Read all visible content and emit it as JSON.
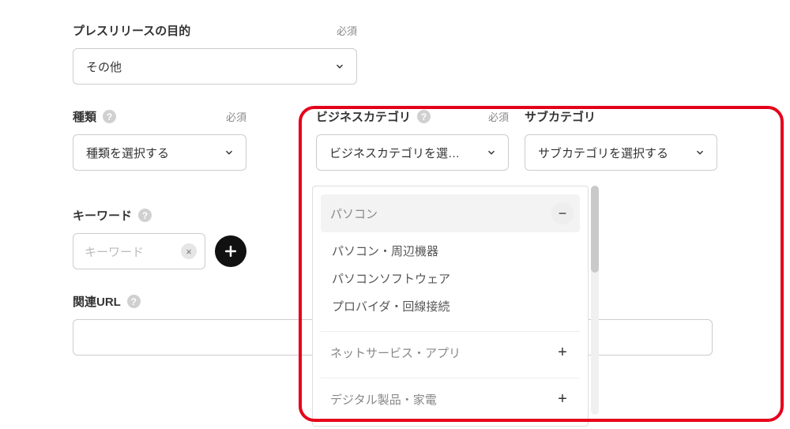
{
  "required_label": "必須",
  "purpose": {
    "label": "プレスリリースの目的",
    "value": "その他"
  },
  "type": {
    "label": "種類",
    "value": "種類を選択する"
  },
  "business_category": {
    "label": "ビジネスカテゴリ",
    "value": "ビジネスカテゴリを選…"
  },
  "sub_category": {
    "label": "サブカテゴリ",
    "value": "サブカテゴリを選択する"
  },
  "keyword": {
    "label": "キーワード",
    "placeholder": "キーワード"
  },
  "related_url": {
    "label": "関連URL"
  },
  "category_panel": {
    "groups": [
      {
        "title": "パソコン",
        "expanded": true,
        "items": [
          "パソコン・周辺機器",
          "パソコンソフトウェア",
          "プロバイダ・回線接続"
        ]
      },
      {
        "title": "ネットサービス・アプリ",
        "expanded": false
      },
      {
        "title": "デジタル製品・家電",
        "expanded": false
      }
    ]
  },
  "icons": {
    "minus": "−",
    "plus": "+",
    "clear": "×"
  }
}
